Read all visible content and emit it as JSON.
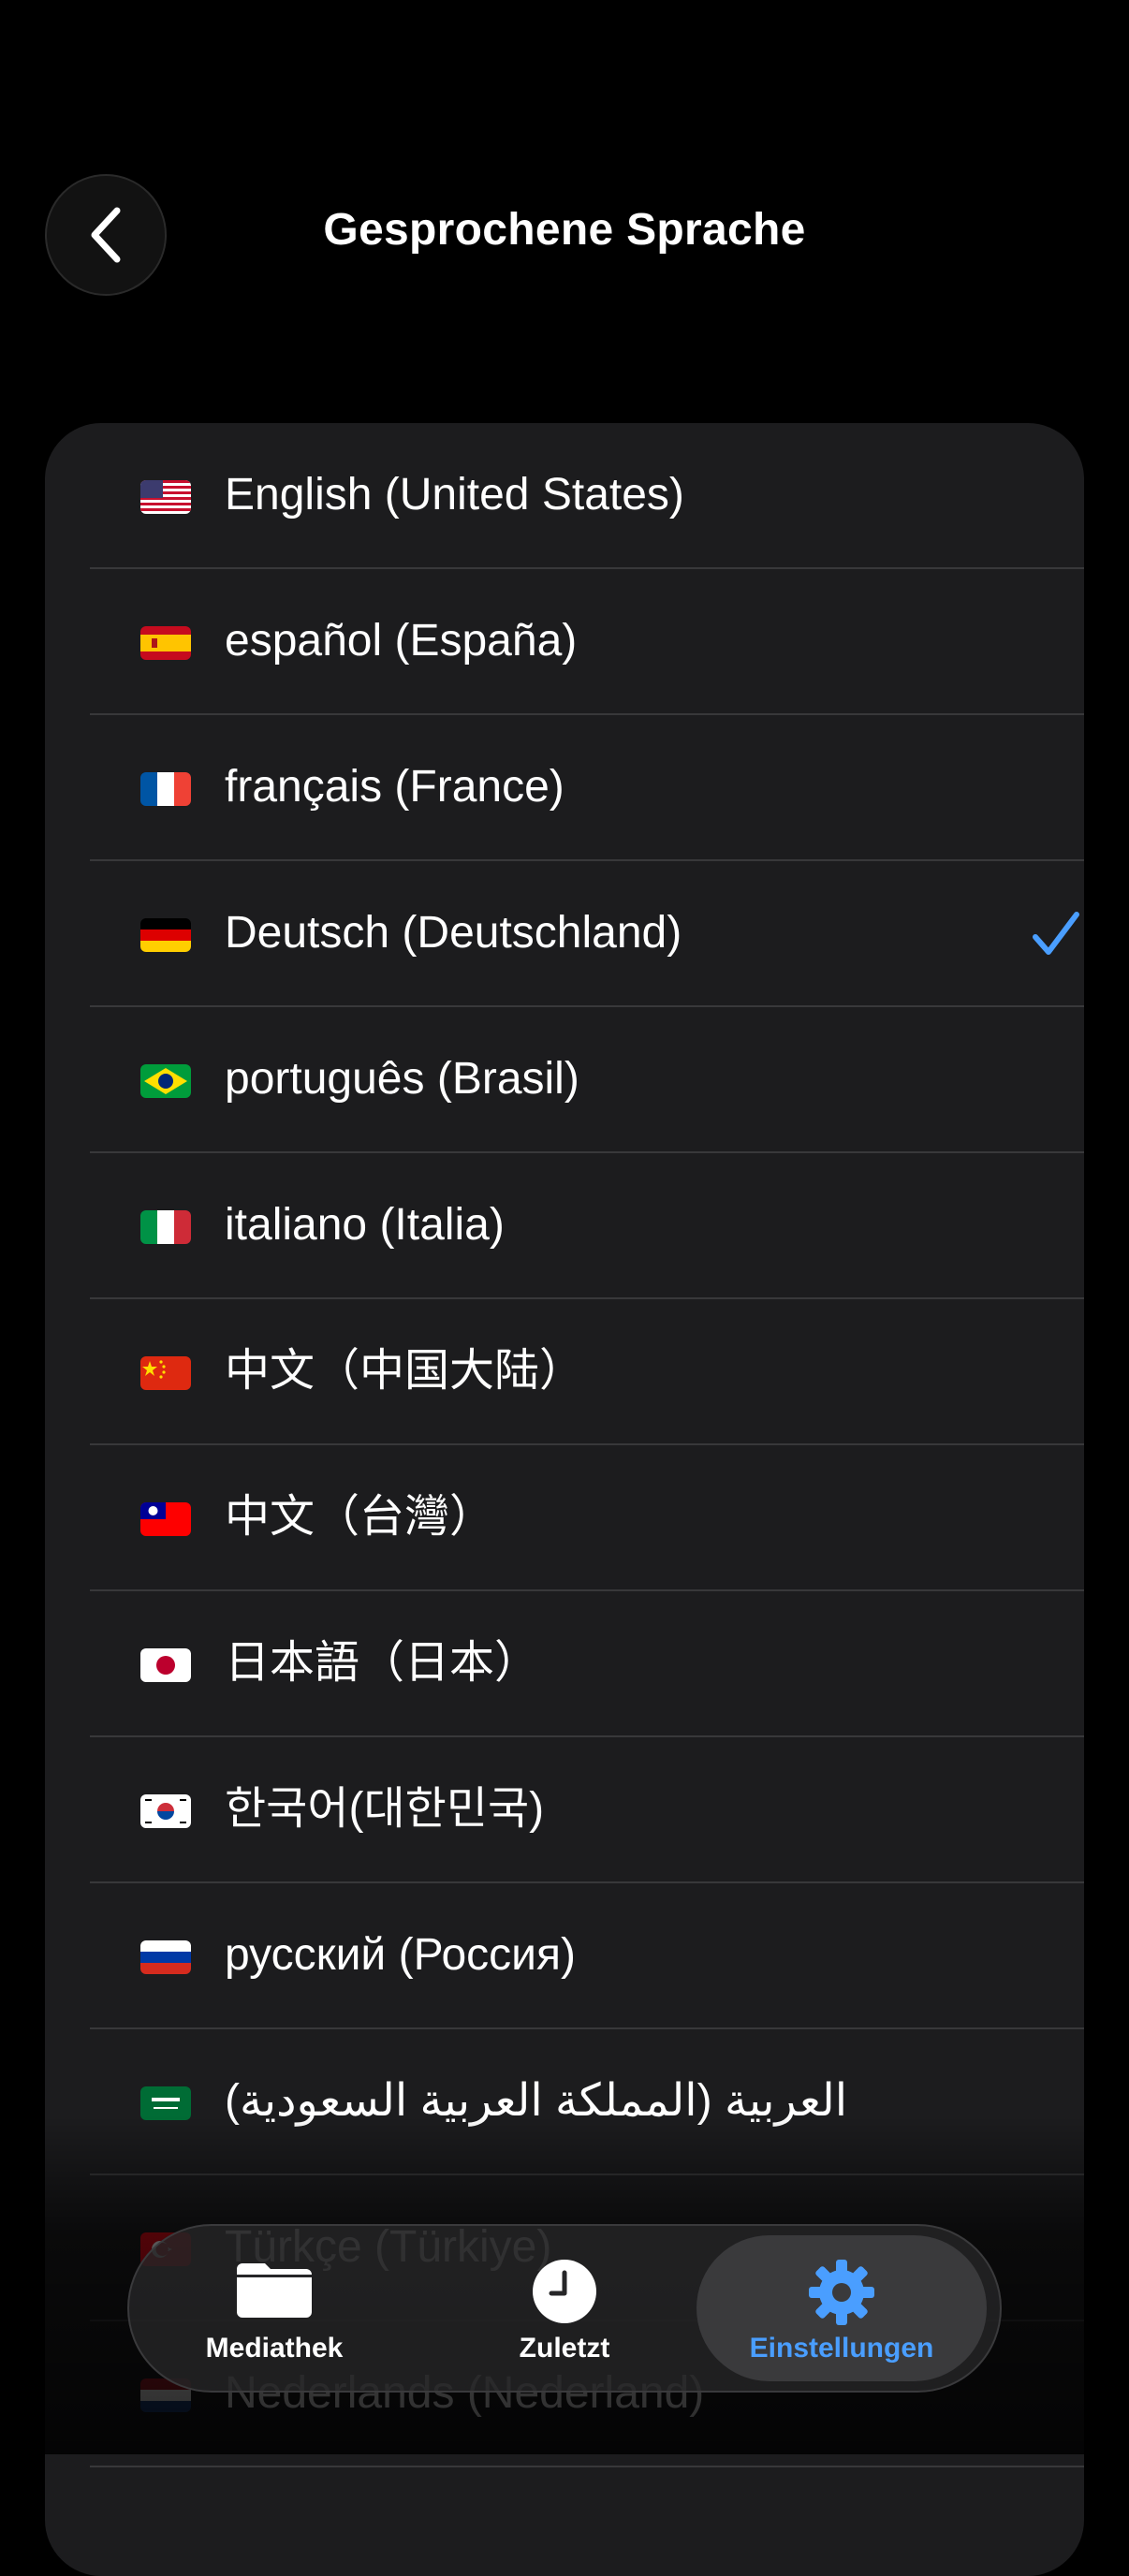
{
  "header": {
    "title": "Gesprochene Sprache"
  },
  "languages": [
    {
      "label": "English (United States)",
      "flag": "us-flag",
      "selected": false
    },
    {
      "label": "español (España)",
      "flag": "es-flag",
      "selected": false
    },
    {
      "label": "français (France)",
      "flag": "fr-flag",
      "selected": false
    },
    {
      "label": "Deutsch (Deutschland)",
      "flag": "de-flag",
      "selected": true
    },
    {
      "label": "português (Brasil)",
      "flag": "br-flag",
      "selected": false
    },
    {
      "label": "italiano (Italia)",
      "flag": "it-flag",
      "selected": false
    },
    {
      "label": "中文（中国大陆）",
      "flag": "cn-flag",
      "selected": false
    },
    {
      "label": "中文（台灣）",
      "flag": "tw-flag",
      "selected": false
    },
    {
      "label": "日本語（日本）",
      "flag": "jp-flag",
      "selected": false
    },
    {
      "label": "한국어(대한민국)",
      "flag": "kr-flag",
      "selected": false
    },
    {
      "label": "русский (Россия)",
      "flag": "ru-flag",
      "selected": false
    },
    {
      "label": "العربية (المملكة العربية السعودية)",
      "flag": "sa-flag",
      "selected": false
    },
    {
      "label": "Türkçe (Türkiye)",
      "flag": "tr-flag",
      "selected": false
    },
    {
      "label": "Nederlands (Nederland)",
      "flag": "nl-flag",
      "selected": false
    }
  ],
  "tabbar": {
    "tabs": [
      {
        "label": "Mediathek",
        "icon": "folder-icon",
        "active": false
      },
      {
        "label": "Zuletzt",
        "icon": "clock-icon",
        "active": false
      },
      {
        "label": "Einstellungen",
        "icon": "gear-icon",
        "active": true
      }
    ]
  },
  "colors": {
    "accent": "#4a9eff",
    "card": "#1c1c1e",
    "background": "#000000"
  }
}
